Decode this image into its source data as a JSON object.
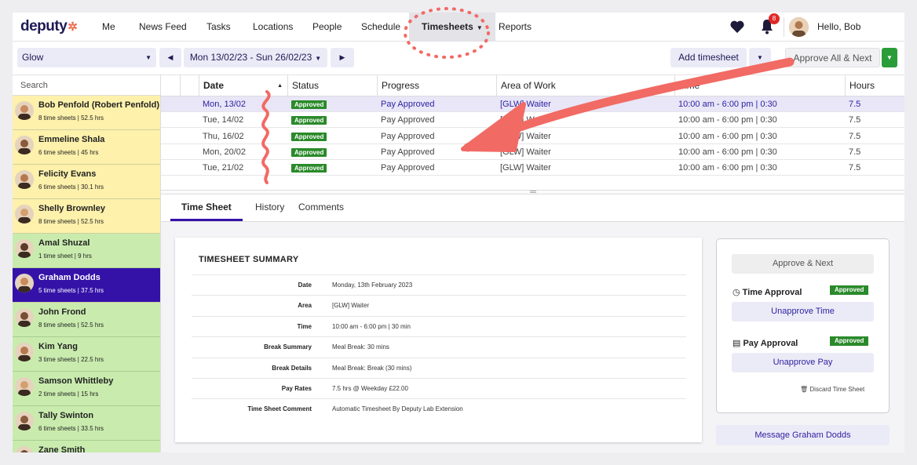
{
  "nav": {
    "logo": "deputy",
    "items": [
      "Me",
      "News Feed",
      "Tasks",
      "Locations",
      "People",
      "Schedule"
    ],
    "active": "Timesheets",
    "reports": "Reports",
    "notifications": "8",
    "user": "Hello, Bob Penfold"
  },
  "toolbar": {
    "location": "Glow",
    "date_range": "Mon 13/02/23 - Sun 26/02/23",
    "add_timesheet": "Add timesheet",
    "approve_all": "Approve All & Next"
  },
  "sidebar": {
    "search": "Search",
    "employees": [
      {
        "name": "Bob Penfold (Robert Penfold)",
        "sub": "8 time sheets | 52.5 hrs",
        "status": "yellow"
      },
      {
        "name": "Emmeline Shala",
        "sub": "6 time sheets | 45 hrs",
        "status": "yellow"
      },
      {
        "name": "Felicity Evans",
        "sub": "6 time sheets | 30.1 hrs",
        "status": "yellow"
      },
      {
        "name": "Shelly Brownley",
        "sub": "8 time sheets | 52.5 hrs",
        "status": "yellow"
      },
      {
        "name": "Amal Shuzal",
        "sub": "1 time sheet | 9 hrs",
        "status": "green"
      },
      {
        "name": "Graham Dodds",
        "sub": "5 time sheets | 37.5 hrs",
        "status": "active"
      },
      {
        "name": "John Frond",
        "sub": "8 time sheets | 52.5 hrs",
        "status": "green"
      },
      {
        "name": "Kim Yang",
        "sub": "3 time sheets | 22.5 hrs",
        "status": "green"
      },
      {
        "name": "Samson Whittleby",
        "sub": "2 time sheets | 15 hrs",
        "status": "green"
      },
      {
        "name": "Tally Swinton",
        "sub": "6 time sheets | 33.5 hrs",
        "status": "green"
      },
      {
        "name": "Zane Smith",
        "sub": "",
        "status": "green"
      }
    ]
  },
  "table": {
    "columns": [
      "Date",
      "Status",
      "Progress",
      "Area of Work",
      "Time",
      "Hours"
    ],
    "rows": [
      {
        "date": "Mon, 13/02",
        "status": "Approved",
        "progress": "Pay Approved",
        "area": "[GLW] Waiter",
        "time": "10:00 am - 6:00 pm | 0:30",
        "hours": "7.5"
      },
      {
        "date": "Tue, 14/02",
        "status": "Approved",
        "progress": "Pay Approved",
        "area": "[GLW] Waiter",
        "time": "10:00 am - 6:00 pm | 0:30",
        "hours": "7.5"
      },
      {
        "date": "Thu, 16/02",
        "status": "Approved",
        "progress": "Pay Approved",
        "area": "[GLW] Waiter",
        "time": "10:00 am - 6:00 pm | 0:30",
        "hours": "7.5"
      },
      {
        "date": "Mon, 20/02",
        "status": "Approved",
        "progress": "Pay Approved",
        "area": "[GLW] Waiter",
        "time": "10:00 am - 6:00 pm | 0:30",
        "hours": "7.5"
      },
      {
        "date": "Tue, 21/02",
        "status": "Approved",
        "progress": "Pay Approved",
        "area": "[GLW] Waiter",
        "time": "10:00 am - 6:00 pm | 0:30",
        "hours": "7.5"
      }
    ]
  },
  "tabs": [
    "Time Sheet",
    "History",
    "Comments"
  ],
  "summary": {
    "title": "TIMESHEET SUMMARY",
    "rows": [
      {
        "label": "Date",
        "value": "Monday, 13th February 2023"
      },
      {
        "label": "Area",
        "value": "[GLW] Waiter"
      },
      {
        "label": "Time",
        "value": "10:00 am - 6:00 pm | 30 min"
      },
      {
        "label": "Break Summary",
        "value": "Meal Break: 30 mins"
      },
      {
        "label": "Break Details",
        "value": "Meal Break: Break (30 mins)"
      },
      {
        "label": "Pay Rates",
        "value": "7.5 hrs @ Weekday £22.00"
      },
      {
        "label": "Time Sheet Comment",
        "value": "Automatic Timesheet By Deputy Lab Extension"
      }
    ]
  },
  "actions": {
    "approve_next": "Approve & Next",
    "time_approval": "Time Approval",
    "time_badge": "Approved",
    "unapprove_time": "Unapprove Time",
    "pay_approval": "Pay Approval",
    "pay_badge": "Approved",
    "unapprove_pay": "Unapprove Pay",
    "discard": "Discard Time Sheet",
    "message": "Message Graham Dodds"
  },
  "colors": {
    "brand": "#3412a8",
    "approved": "#2a8a2a",
    "annotation": "#f26a64"
  }
}
